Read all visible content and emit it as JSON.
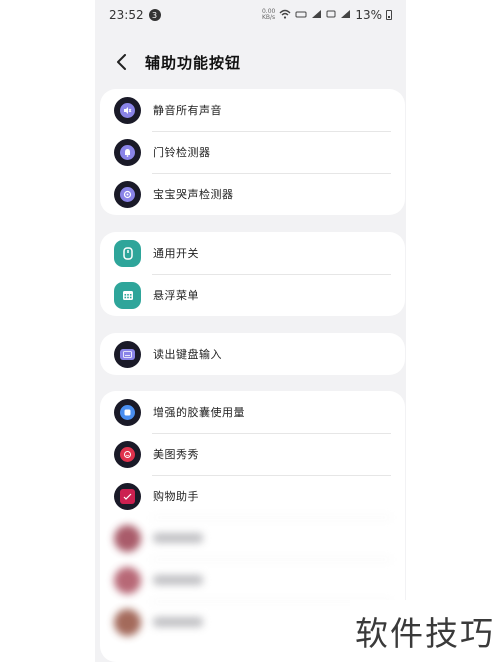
{
  "status_bar": {
    "time": "23:52",
    "badge": "3",
    "net_speed": "0.00\nKB/s",
    "battery_pct": "13%"
  },
  "header": {
    "back_icon": "chevron-left-icon",
    "title": "辅助功能按钮"
  },
  "groups": [
    {
      "items": [
        {
          "label": "静音所有声音",
          "icon": "mute-icon",
          "color": "#8a84e8"
        },
        {
          "label": "门铃检测器",
          "icon": "bell-icon",
          "color": "#8a84e8"
        },
        {
          "label": "宝宝哭声检测器",
          "icon": "baby-icon",
          "color": "#8a84e8"
        }
      ]
    },
    {
      "items": [
        {
          "label": "通用开关",
          "icon": "switch-icon",
          "color": "#2ea59a"
        },
        {
          "label": "悬浮菜单",
          "icon": "grid-menu-icon",
          "color": "#2ea59a"
        }
      ]
    },
    {
      "items": [
        {
          "label": "读出键盘输入",
          "icon": "keyboard-icon",
          "color": "#8a84e8"
        }
      ]
    },
    {
      "items": [
        {
          "label": "增强的胶囊使用量",
          "icon": "capsule-icon",
          "color": "#4a8ef0"
        },
        {
          "label": "美图秀秀",
          "icon": "meitu-icon",
          "color": "#e0324d"
        },
        {
          "label": "购物助手",
          "icon": "shopping-icon",
          "color": "#cc2050"
        }
      ]
    }
  ],
  "watermark": "软件技巧"
}
